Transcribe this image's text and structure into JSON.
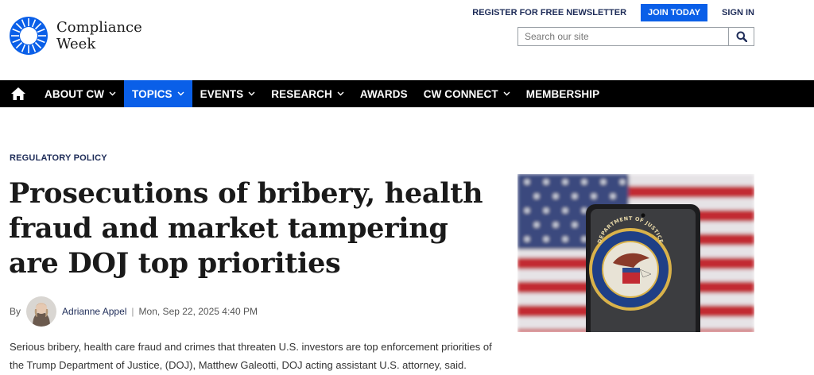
{
  "site": {
    "logo_line1": "Compliance",
    "logo_line2": "Week",
    "newsletter_label": "REGISTER FOR FREE NEWSLETTER",
    "join_label": "JOIN TODAY",
    "signin_label": "SIGN IN",
    "search_placeholder": "Search our site",
    "search_value": ""
  },
  "nav": {
    "items": [
      {
        "label": "ABOUT CW",
        "dropdown": true
      },
      {
        "label": "TOPICS",
        "dropdown": true,
        "active": true
      },
      {
        "label": "EVENTS",
        "dropdown": true
      },
      {
        "label": "RESEARCH",
        "dropdown": true
      },
      {
        "label": "AWARDS",
        "dropdown": false
      },
      {
        "label": "CW CONNECT",
        "dropdown": true
      },
      {
        "label": "MEMBERSHIP",
        "dropdown": false
      }
    ]
  },
  "article": {
    "kicker": "REGULATORY POLICY",
    "headline": "Prosecutions of bribery, health fraud and market tampering are DOJ top priorities",
    "by": "By",
    "author": "Adrianne Appel",
    "separator": "|",
    "date": "Mon, Sep 22, 2025 4:40 PM",
    "body": "Serious bribery, health care fraud and crimes that threaten U.S. investors are top enforcement priorities of the Trump Department of Justice, (DOJ), Matthew Galeotti, DOJ acting assistant U.S. attorney, said.",
    "image_seal_text": "DEPARTMENT OF JUSTICE"
  },
  "colors": {
    "brand_blue": "#0a5fe8",
    "nav_bg": "#000000",
    "link_navy": "#1e2c58"
  }
}
